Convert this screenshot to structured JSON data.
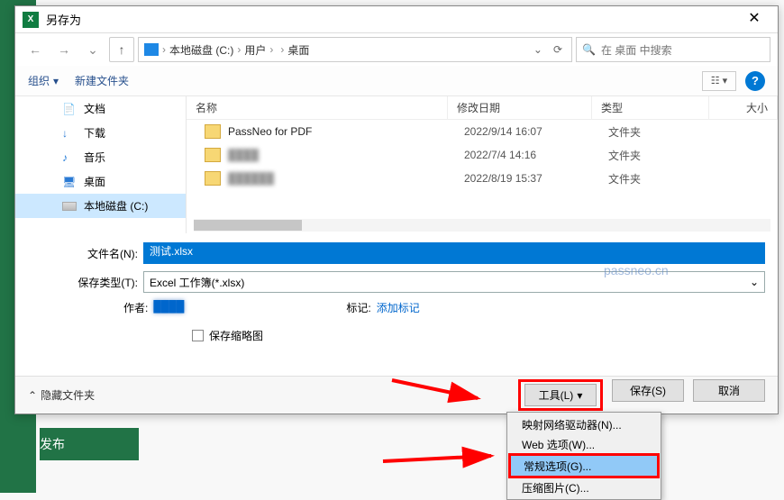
{
  "bg": {
    "publish": "发布"
  },
  "dialog": {
    "title": "另存为",
    "close": "✕"
  },
  "nav": {
    "back": "←",
    "forward": "→",
    "recent": "⌄",
    "up": "↑",
    "crumbs": [
      "本地磁盘 (C:)",
      "用户",
      "",
      "桌面"
    ],
    "sep": "›",
    "dd": "⌄",
    "refresh": "⟳",
    "search_placeholder": "在 桌面 中搜索",
    "search_icon": "🔍"
  },
  "toolbar": {
    "organize": "组织",
    "newfolder": "新建文件夹",
    "view": "☷ ▾",
    "help": "?"
  },
  "sidebar": [
    {
      "icon": "📄",
      "cls": "ic-doc",
      "label": "文档"
    },
    {
      "icon": "↓",
      "cls": "ic-dl",
      "label": "下载"
    },
    {
      "icon": "♪",
      "cls": "ic-music",
      "label": "音乐"
    },
    {
      "icon": "🖥",
      "cls": "ic-desk",
      "label": "桌面"
    },
    {
      "icon": "",
      "cls": "ic-disk",
      "label": "本地磁盘 (C:)",
      "sel": true
    }
  ],
  "filelist": {
    "headers": {
      "name": "名称",
      "date": "修改日期",
      "type": "类型",
      "size": "大小"
    },
    "rows": [
      {
        "name": "PassNeo for PDF",
        "date": "2022/9/14 16:07",
        "type": "文件夹"
      },
      {
        "name": "████",
        "date": "2022/7/4 14:16",
        "type": "文件夹",
        "blur": true
      },
      {
        "name": "██████",
        "date": "2022/8/19 15:37",
        "type": "文件夹",
        "blur": true
      }
    ]
  },
  "form": {
    "filename_label": "文件名(N):",
    "filename_value": "测试.xlsx",
    "filetype_label": "保存类型(T):",
    "filetype_value": "Excel 工作簿(*.xlsx)",
    "author_label": "作者:",
    "author_value": "████",
    "tag_label": "标记:",
    "tag_value": "添加标记",
    "thumb_label": "保存缩略图"
  },
  "footer": {
    "hide": "隐藏文件夹",
    "tools": "工具(L)",
    "save": "保存(S)",
    "cancel": "取消"
  },
  "menu": [
    "映射网络驱动器(N)...",
    "Web 选项(W)...",
    "常规选项(G)...",
    "压缩图片(C)..."
  ],
  "watermark": "passneo.cn"
}
